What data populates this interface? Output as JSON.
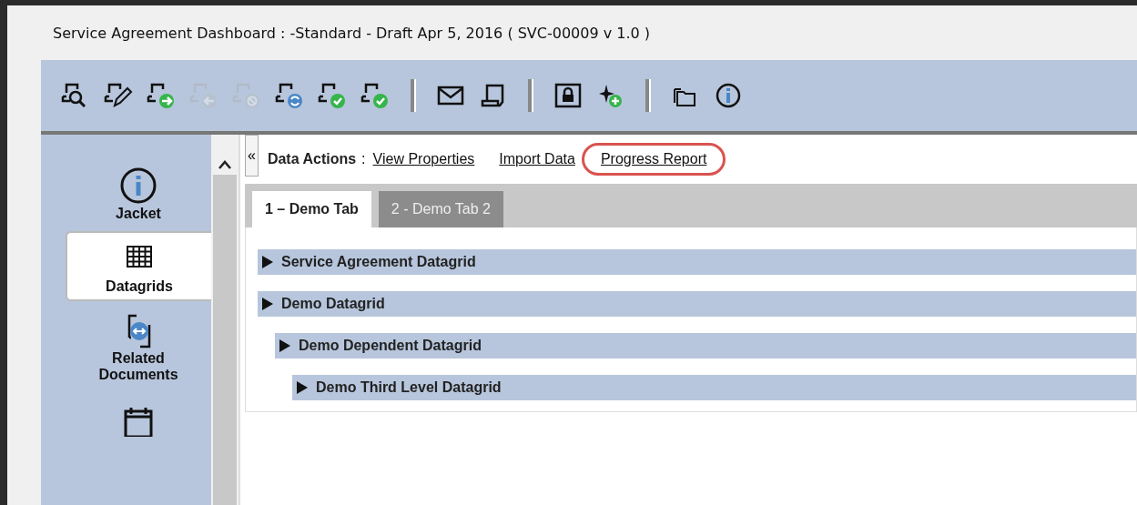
{
  "window": {
    "title": "Service Agreement  Dashboard : -Standard - Draft Apr 5, 2016 ( SVC-00009 v 1.0 )"
  },
  "toolbar": {
    "groups": [
      [
        {
          "disabled": false
        },
        {
          "disabled": false
        },
        {
          "disabled": false
        },
        {
          "disabled": true
        },
        {
          "disabled": true
        },
        {
          "disabled": false
        },
        {
          "disabled": false
        },
        {
          "disabled": false
        }
      ],
      [
        {
          "disabled": false
        },
        {
          "disabled": false
        }
      ],
      [
        {
          "disabled": false
        },
        {
          "disabled": false
        }
      ],
      [
        {
          "disabled": false
        },
        {
          "disabled": false
        }
      ]
    ]
  },
  "sidebar": {
    "items": [
      {
        "label": "Jacket",
        "selected": false
      },
      {
        "label": "Datagrids",
        "selected": true
      },
      {
        "label": "Related Documents",
        "selected": false
      },
      {
        "selected": false
      }
    ]
  },
  "data_actions": {
    "label": "Data Actions",
    "separator": ":",
    "links": [
      {
        "label": "View Properties",
        "highlighted": false
      },
      {
        "label": "Import Data",
        "highlighted": false
      },
      {
        "label": "Progress Report",
        "highlighted": true
      }
    ]
  },
  "collapse_button": "«",
  "tabs": [
    {
      "label": "1 – Demo Tab",
      "selected": true
    },
    {
      "label": "2 - Demo Tab 2",
      "selected": false
    }
  ],
  "datagrids": [
    {
      "label": "Service Agreement Datagrid"
    },
    {
      "label": "Demo Datagrid",
      "children": [
        {
          "label": "Demo Dependent Datagrid",
          "children": [
            {
              "label": "Demo Third Level Datagrid"
            }
          ]
        }
      ]
    }
  ]
}
